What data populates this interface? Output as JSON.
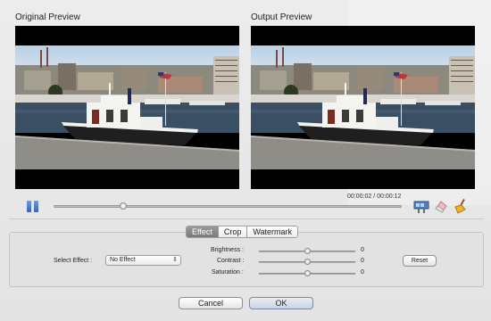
{
  "preview": {
    "original_title": "Original Preview",
    "output_title": "Output Preview"
  },
  "playback": {
    "timecode": "00:00:02 / 00:00:12",
    "progress": 0.2
  },
  "tabs": [
    {
      "label": "Effect",
      "active": true
    },
    {
      "label": "Crop",
      "active": false
    },
    {
      "label": "Watermark",
      "active": false
    }
  ],
  "effect": {
    "select_label": "Select Effect :",
    "select_value": "No Effect",
    "brightness_label": "Brightness :",
    "brightness_value": "0",
    "contrast_label": "Contrast :",
    "contrast_value": "0",
    "saturation_label": "Saturation :",
    "saturation_value": "0",
    "slider_level": 0.5,
    "reset_label": "Reset"
  },
  "dialog": {
    "cancel_label": "Cancel",
    "ok_label": "OK"
  },
  "colors": {
    "accent_blue": "#2f64b8",
    "ok_button": "#c8d3e2"
  }
}
